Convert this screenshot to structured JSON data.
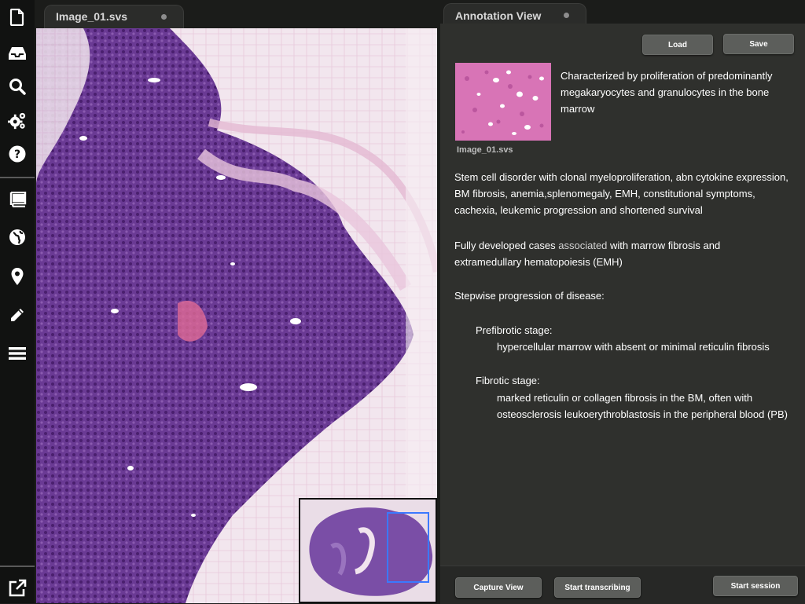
{
  "sidebar": {
    "icons": [
      "file-icon",
      "inbox-icon",
      "search-icon",
      "gears-icon",
      "help-icon",
      "book-icon",
      "globe-icon",
      "map-pin-icon",
      "pencil-icon",
      "menu-icon",
      "external-link-icon"
    ]
  },
  "tabs": {
    "image_tab": "Image_01.svs",
    "annotation_tab": "Annotation View"
  },
  "toolbar": {
    "load_label": "Load",
    "save_label": "Save"
  },
  "annotation": {
    "thumbnail_caption": "Image_01.svs",
    "summary": "Characterized by proliferation of predominantly megakaryocytes and granulocytes in the bone marrow",
    "paragraph1": "Stem cell disorder with clonal myeloproliferation, abn cytokine expression, BM fibrosis, anemia,splenomegaly, EMH, constitutional symptoms, cachexia, leukemic progression and shortened survival",
    "paragraph2_a": "Fully developed cases ",
    "paragraph2_b": "associated",
    "paragraph2_c": " with marrow fibrosis and extramedullary hematopoiesis (EMH)",
    "progression_heading": "Stepwise progression of disease:",
    "stage1_title": "Prefibrotic stage:",
    "stage1_desc": "hypercellular marrow with absent or minimal reticulin fibrosis",
    "stage2_title": "Fibrotic stage:",
    "stage2_desc": "marked reticulin or collagen fibrosis in the BM, often with osteosclerosis leukoerythroblastosis in the peripheral blood (PB)"
  },
  "footer": {
    "capture_label": "Capture View",
    "transcribe_label": "Start transcribing",
    "session_label": "Start session"
  },
  "colors": {
    "panel_bg": "#2f302d",
    "button_bg": "#5c5e5b",
    "tissue_dark": "#5b2d86",
    "tissue_light": "#e9c6dc",
    "minimap_highlight": "#3b79ff"
  }
}
